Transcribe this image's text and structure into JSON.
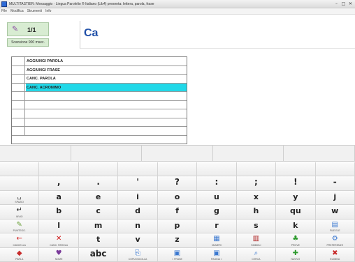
{
  "window": {
    "title": "MULTITASTIER: Messaggio · Lingua Parolelio ® Italiano (Lib4) presenta: lettera, parola, frase",
    "controls": [
      "–",
      "□",
      "✕"
    ]
  },
  "menubar": {
    "items": [
      "File",
      "Modifica",
      "Strumenti",
      "Info"
    ]
  },
  "status": {
    "page_counter": "1/1",
    "scan_label": "Scansione 900 msec."
  },
  "editor": {
    "text": "Ca"
  },
  "prediction": {
    "items": [
      "AGGIUNGI PAROLA",
      "AGGIUNGI FRASE",
      "CANC. PAROLA",
      "CANC. ACRONIMO",
      "",
      "",
      "",
      "",
      ""
    ],
    "selected_index": 3
  },
  "colors": {
    "selected": "#21d8e8",
    "editor_text": "#1f4fa8",
    "panel_green": "#d8ecd2"
  },
  "keyboard": {
    "rows": [
      [
        {
          "glyph": ""
        },
        {
          "glyph": ","
        },
        {
          "glyph": "."
        },
        {
          "glyph": "'"
        },
        {
          "glyph": "?"
        },
        {
          "glyph": ":"
        },
        {
          "glyph": ";"
        },
        {
          "glyph": "!"
        },
        {
          "glyph": "-"
        }
      ],
      [
        {
          "icon": "space-icon",
          "sym": "␣",
          "color": "#555",
          "sub": "SPAZIO"
        },
        {
          "glyph": "a"
        },
        {
          "glyph": "e"
        },
        {
          "glyph": "i"
        },
        {
          "glyph": "o"
        },
        {
          "glyph": "u"
        },
        {
          "glyph": "x"
        },
        {
          "glyph": "y"
        },
        {
          "glyph": "j"
        }
      ],
      [
        {
          "icon": "enter-icon",
          "sym": "↵",
          "color": "#222",
          "sub": "INVIO"
        },
        {
          "glyph": "b"
        },
        {
          "glyph": "c"
        },
        {
          "glyph": "d"
        },
        {
          "glyph": "f"
        },
        {
          "glyph": "g"
        },
        {
          "glyph": "h"
        },
        {
          "glyph": "qu"
        },
        {
          "glyph": "w"
        }
      ],
      [
        {
          "icon": "punctuation-icon",
          "sym": "✎",
          "color": "#6aa03a",
          "sub": "PUNTEGG."
        },
        {
          "glyph": "l"
        },
        {
          "glyph": "m"
        },
        {
          "glyph": "n"
        },
        {
          "glyph": "p"
        },
        {
          "glyph": "r"
        },
        {
          "glyph": "s"
        },
        {
          "glyph": "k"
        },
        {
          "icon": "file-icon",
          "sym": "▤",
          "color": "#3a78d0",
          "sub": "FILE ELE"
        }
      ],
      [
        {
          "icon": "delete-icon",
          "sym": "←",
          "color": "#d02020",
          "sub": "CANCELLA"
        },
        {
          "icon": "delete-word-icon",
          "sym": "✕",
          "color": "#d02020",
          "sub": "CANC. PAROLA"
        },
        {
          "glyph": "t"
        },
        {
          "glyph": "v"
        },
        {
          "glyph": "z"
        },
        {
          "icon": "numbers-icon",
          "sym": "▦",
          "color": "#3a78d0",
          "sub": "NUMERI"
        },
        {
          "icon": "symbols-icon",
          "sym": "▥",
          "color": "#b02828",
          "sub": "SIMBOLI"
        },
        {
          "icon": "proofs-icon",
          "sym": "♣",
          "color": "#2e9a2e",
          "sub": "PROVE"
        },
        {
          "icon": "preferences-icon",
          "sym": "⚙",
          "color": "#3a78d0",
          "sub": "PREFERENZE"
        }
      ],
      [
        {
          "icon": "speak-icon",
          "sym": "◆",
          "color": "#c82c2c",
          "sub": "PARLA"
        },
        {
          "icon": "name-icon",
          "sym": "♥",
          "color": "#7a3a9a",
          "sub": "NOME"
        },
        {
          "glyph": "abc",
          "big": true
        },
        {
          "icon": "copy-paste-icon",
          "sym": "⎘",
          "color": "#3a78d0",
          "sub": "COPIA INCOLLA"
        },
        {
          "icon": "next-sentence-icon",
          "sym": "▣",
          "color": "#3a78d0",
          "sub": "< FRASE"
        },
        {
          "icon": "next-page-icon",
          "sym": "▣",
          "color": "#3a78d0",
          "sub": "PAGINA >"
        },
        {
          "icon": "search-icon",
          "sym": "⌕",
          "color": "#3a78d0",
          "sub": "CERCA"
        },
        {
          "icon": "new-icon",
          "sym": "✚",
          "color": "#2e9a2e",
          "sub": "NUOVO"
        },
        {
          "icon": "delete-all-icon",
          "sym": "✖",
          "color": "#c82c2c",
          "sub": "ELIMINA"
        }
      ]
    ]
  }
}
